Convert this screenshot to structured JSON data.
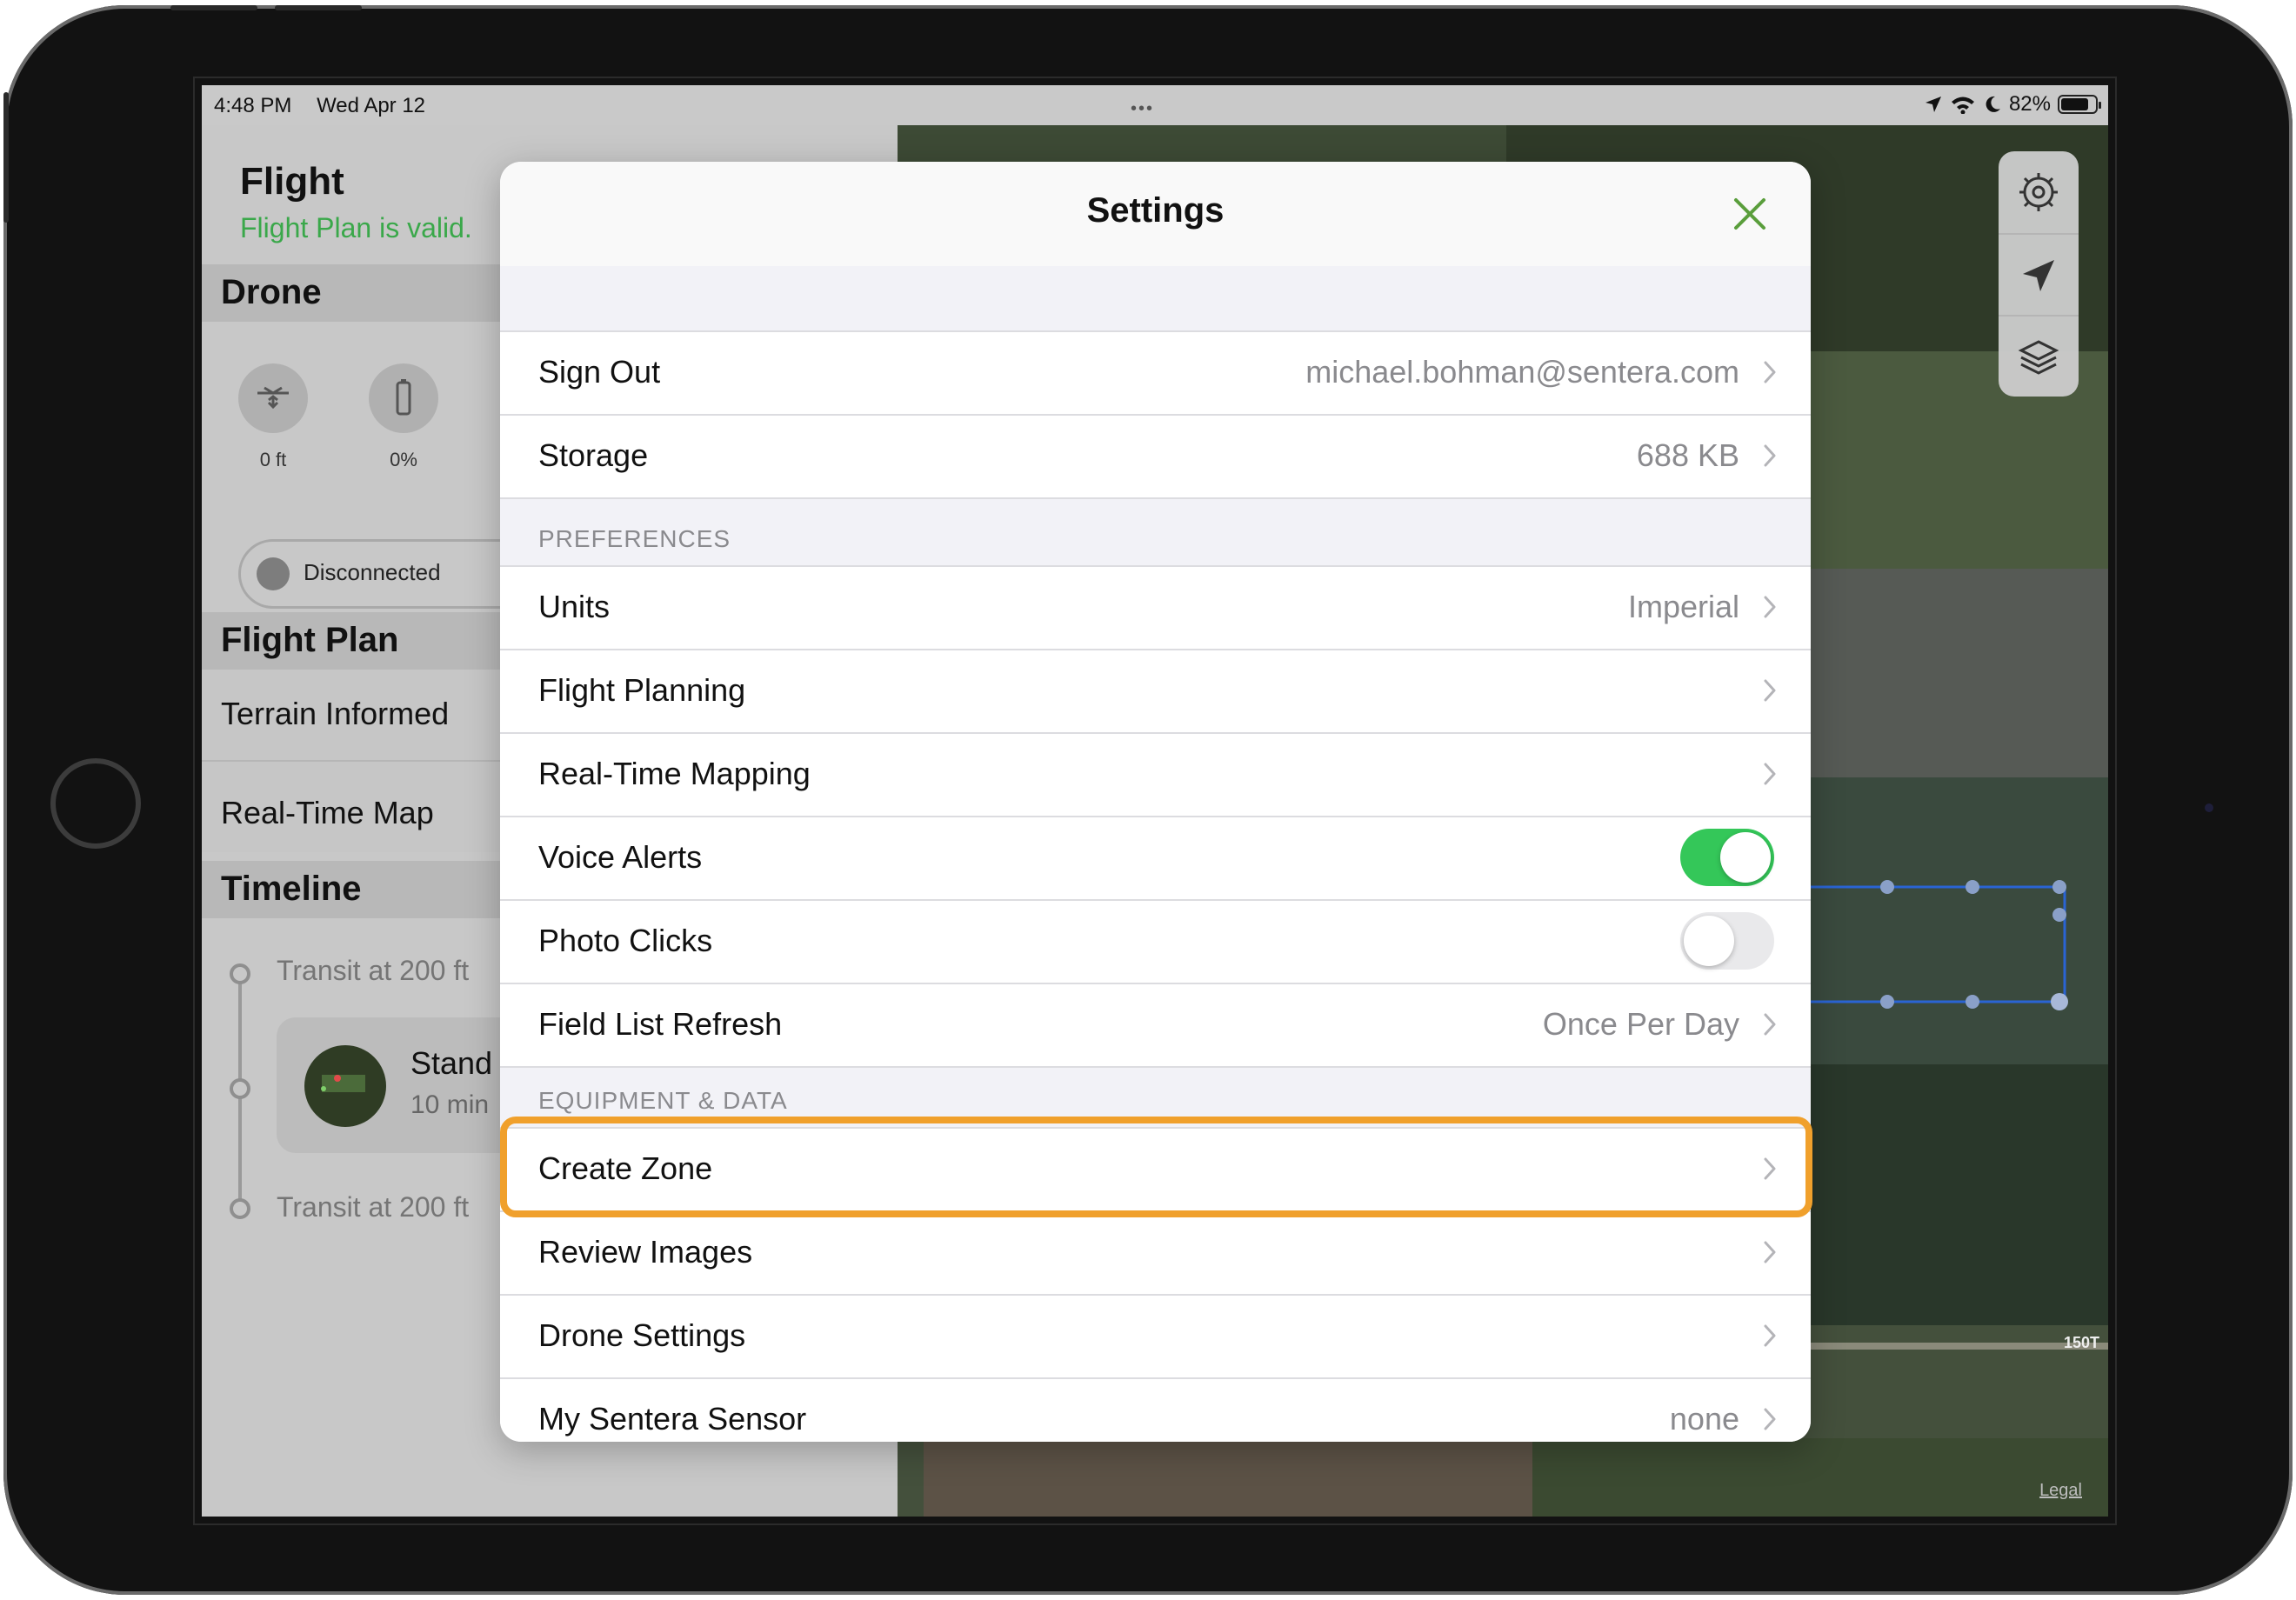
{
  "status_bar": {
    "time": "4:48 PM",
    "date": "Wed Apr 12",
    "battery": "82%",
    "battery_level": 0.82,
    "multitasking_dots": "•••"
  },
  "left_panel": {
    "title": "Flight",
    "subtitle": "Flight Plan is valid.",
    "drone_section": "Drone",
    "altitude_value": "0 ft",
    "battery_value": "0%",
    "connection_status": "Disconnected",
    "flight_plan_section": "Flight Plan",
    "flight_plan_items": [
      "Terrain Informed",
      "Real-Time Map"
    ],
    "timeline_section": "Timeline",
    "timeline": {
      "first": "Transit at 200 ft",
      "card_title": "Stand",
      "card_sub": "10 min",
      "last": "Transit at 200 ft"
    }
  },
  "map": {
    "road_label": "150T",
    "legal": "Legal",
    "tools": [
      "settings-gear-icon",
      "location-arrow-icon",
      "layers-icon"
    ]
  },
  "settings": {
    "title": "Settings",
    "account": [
      {
        "label": "Sign Out",
        "value": "michael.bohman@sentera.com"
      },
      {
        "label": "Storage",
        "value": "688 KB"
      }
    ],
    "preferences_header": "PREFERENCES",
    "preferences": [
      {
        "label": "Units",
        "value": "Imperial"
      },
      {
        "label": "Flight Planning",
        "value": ""
      },
      {
        "label": "Real-Time Mapping",
        "value": ""
      },
      {
        "label": "Voice Alerts",
        "toggle": true
      },
      {
        "label": "Photo Clicks",
        "toggle": false
      },
      {
        "label": "Field List Refresh",
        "value": "Once Per Day"
      }
    ],
    "equipment_header": "EQUIPMENT & DATA",
    "equipment": [
      {
        "label": "Create Zone",
        "value": ""
      },
      {
        "label": "Review Images",
        "value": ""
      },
      {
        "label": "Drone Settings",
        "value": ""
      },
      {
        "label": "My Sentera Sensor",
        "value": "none"
      }
    ]
  },
  "colors": {
    "accent_green": "#3aa84a",
    "toggle_on": "#34c759",
    "toggle_off": "#e9e9eb",
    "highlight": "#f0a02c",
    "close_icon": "#5a9e3c"
  }
}
